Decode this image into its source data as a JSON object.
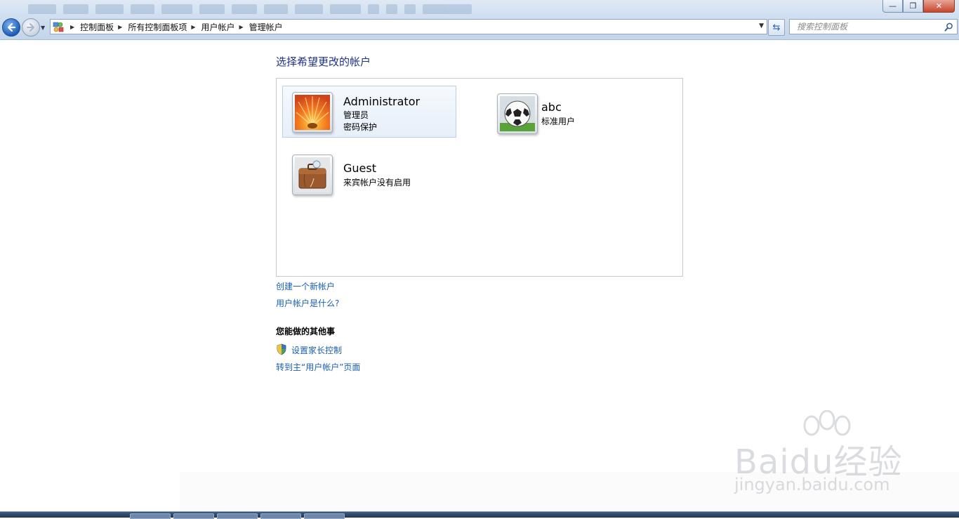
{
  "window": {
    "minimize_glyph": "—",
    "restore_glyph": "❐",
    "close_glyph": "✕"
  },
  "nav": {
    "back_icon": "back-arrow-icon",
    "forward_icon": "forward-arrow-icon"
  },
  "breadcrumb": {
    "items": [
      "控制面板",
      "所有控制面板项",
      "用户帐户",
      "管理帐户"
    ]
  },
  "search": {
    "placeholder": "搜索控制面板"
  },
  "main": {
    "title": "选择希望更改的帐户",
    "accounts": [
      {
        "name": "Administrator",
        "lines": [
          "管理员",
          "密码保护"
        ],
        "avatar": "flower-avatar",
        "selected": true
      },
      {
        "name": "abc",
        "lines": [
          "标准用户"
        ],
        "avatar": "soccer-ball-avatar",
        "selected": false
      },
      {
        "name": "Guest",
        "lines": [
          "来宾帐户没有启用"
        ],
        "avatar": "briefcase-avatar",
        "selected": false
      }
    ],
    "links": {
      "create_account": "创建一个新帐户",
      "what_is_account": "用户帐户是什么?"
    },
    "other_tasks": {
      "heading": "您能做的其他事",
      "parental_controls": "设置家长控制",
      "go_to_main": "转到主“用户帐户”页面"
    }
  },
  "watermark": {
    "brand": "Baidu经验",
    "url": "jingyan.baidu.com"
  },
  "colors": {
    "title": "#1e3287",
    "link": "#1a5fb4",
    "selection_border": "#b8d0ea"
  }
}
